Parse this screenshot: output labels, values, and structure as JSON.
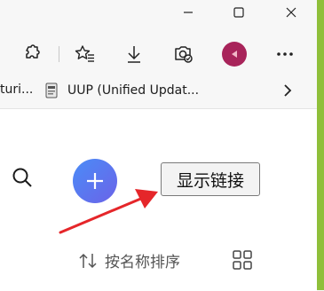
{
  "window": {
    "minimize_icon": "minimize-icon",
    "maximize_icon": "maximize-icon",
    "close_icon": "close-icon"
  },
  "toolbar": {
    "icons": [
      "extensions-icon",
      "favorites-icon",
      "downloads-icon",
      "browser-essentials-icon",
      "profile-avatar",
      "more-icon"
    ],
    "avatar_color": "#a8245a"
  },
  "favorites": {
    "cut_label": "turi...",
    "item_label": "UUP (Unified Updat...",
    "item_icon": "file-icon",
    "more_icon": "chevron-right-icon"
  },
  "content": {
    "search_icon": "search-icon",
    "add_icon": "plus-icon",
    "show_links_label": "显示链接",
    "sort_label": "按名称排序",
    "sort_icon": "sort-arrows-icon",
    "view_icon": "grid-view-icon",
    "annotation_color": "#e5262a",
    "accent_gradient": [
      "#4a8cf7",
      "#6b63e8"
    ]
  }
}
